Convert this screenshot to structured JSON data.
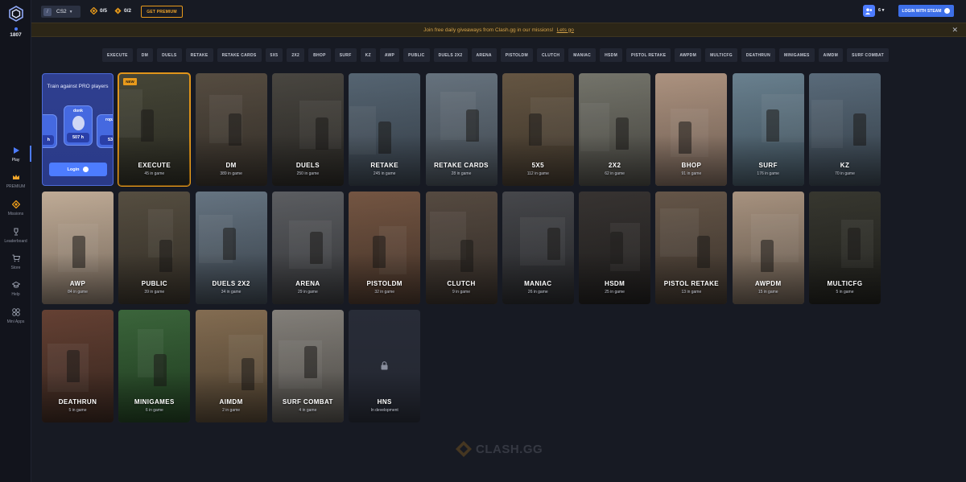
{
  "sidebar": {
    "online_count": "1807",
    "items": [
      {
        "label": "Play",
        "icon": "play-icon"
      },
      {
        "label": "PREMIUM",
        "icon": "crown-icon"
      },
      {
        "label": "Missions",
        "icon": "diamond-icon"
      },
      {
        "label": "Leaderboard",
        "icon": "trophy-icon"
      },
      {
        "label": "Store",
        "icon": "cart-icon"
      },
      {
        "label": "Help",
        "icon": "graduation-cap-icon"
      },
      {
        "label": "Mini Apps",
        "icon": "grid-icon"
      }
    ]
  },
  "header": {
    "game": "CS2",
    "missions_counter": "0/5",
    "bonus_counter": "0/2",
    "premium_label": "GET PREMIUM",
    "friends_count": "6",
    "login_steam_label": "LOGIN WITH STEAM"
  },
  "banner": {
    "text": "Join free daily giveaways from Clash.gg in our missions!",
    "link": "Lets go"
  },
  "filters": [
    "EXECUTE",
    "DM",
    "DUELS",
    "RETAKE",
    "RETAKE CARDS",
    "5X5",
    "2X2",
    "BHOP",
    "SURF",
    "KZ",
    "AWP",
    "PUBLIC",
    "DUELS 2X2",
    "ARENA",
    "PISTOLDM",
    "CLUTCH",
    "MANIAC",
    "HSDM",
    "PISTOL RETAKE",
    "AWPDM",
    "MULTICFG",
    "DEATHRUN",
    "MINIGAMES",
    "AIMDM",
    "SURF COMBAT"
  ],
  "promo": {
    "title": "Train against PRO players",
    "pro_left_hours": "h",
    "pro_center_name": "donk",
    "pro_center_hours": "507 h",
    "pro_right_name": "ropz",
    "pro_right_hours": "53",
    "login_label": "Login"
  },
  "modes": [
    {
      "name": "EXECUTE",
      "players": "45 in game",
      "badge": "NEW"
    },
    {
      "name": "DM",
      "players": "389 in game"
    },
    {
      "name": "DUELS",
      "players": "250 in game"
    },
    {
      "name": "RETAKE",
      "players": "245 in game"
    },
    {
      "name": "RETAKE CARDS",
      "players": "28 in game"
    },
    {
      "name": "5X5",
      "players": "112 in game"
    },
    {
      "name": "2X2",
      "players": "62 in game"
    },
    {
      "name": "BHOP",
      "players": "91 in game"
    },
    {
      "name": "SURF",
      "players": "176 in game"
    },
    {
      "name": "KZ",
      "players": "70 in game"
    },
    {
      "name": "AWP",
      "players": "84 in game"
    },
    {
      "name": "PUBLIC",
      "players": "39 in game"
    },
    {
      "name": "DUELS 2X2",
      "players": "34 in game"
    },
    {
      "name": "ARENA",
      "players": "29 in game"
    },
    {
      "name": "PISTOLDM",
      "players": "32 in game"
    },
    {
      "name": "CLUTCH",
      "players": "9 in game"
    },
    {
      "name": "MANIAC",
      "players": "26 in game"
    },
    {
      "name": "HSDM",
      "players": "25 in game"
    },
    {
      "name": "PISTOL RETAKE",
      "players": "13 in game"
    },
    {
      "name": "AWPDM",
      "players": "15 in game"
    },
    {
      "name": "MULTICFG",
      "players": "5 in game"
    },
    {
      "name": "DEATHRUN",
      "players": "5 in game"
    },
    {
      "name": "MINIGAMES",
      "players": "6 in game"
    },
    {
      "name": "AIMDM",
      "players": "2 in game"
    },
    {
      "name": "SURF COMBAT",
      "players": "4 in game"
    },
    {
      "name": "HNS",
      "players": "In development",
      "locked": true
    }
  ],
  "watermark": "CLASH.GG"
}
